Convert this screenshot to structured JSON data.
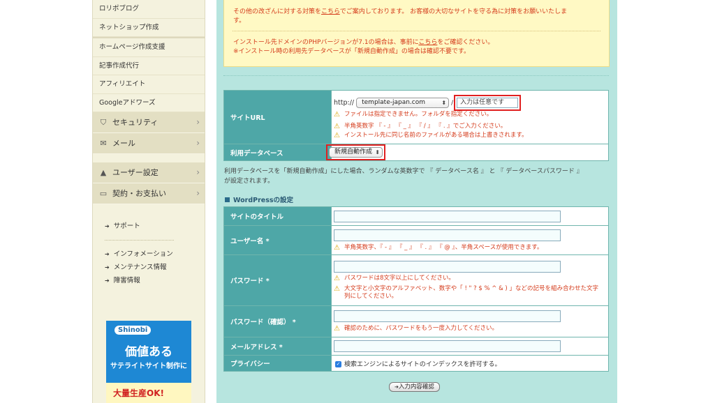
{
  "sidebar": {
    "links_top": [
      "ロリポブログ",
      "ネットショップ作成"
    ],
    "links_group2": [
      "ホームページ作成支援",
      "記事作成代行",
      "アフィリエイト",
      "Googleアドワーズ"
    ],
    "categories": [
      {
        "label": "セキュリティ",
        "icon": "shield-icon",
        "glyph": "⛉"
      },
      {
        "label": "メール",
        "icon": "mail-icon",
        "glyph": "✉"
      }
    ],
    "categories2": [
      {
        "label": "ユーザー設定",
        "icon": "user-icon",
        "glyph": "👤"
      },
      {
        "label": "契約・お支払い",
        "icon": "card-icon",
        "glyph": "▭"
      }
    ],
    "support": [
      "サポート"
    ],
    "info": [
      "インフォメーション",
      "メンテナンス情報",
      "障害情報"
    ],
    "banner": {
      "logo": "Shinobi",
      "main": "価値ある",
      "sub": "サテライトサイト制作に",
      "bottom": "大量生産OK!"
    }
  },
  "notice": {
    "line1_pre": "その他の改ざんに対する対策を",
    "line1_link": "こちら",
    "line1_post": "でご案内しております。 お客様の大切なサイトを守る為に対策をお願いいたしま",
    "line1_cont": "す。",
    "line2_pre": "インストール先ドメインのPHPバージョンが7.1の場合は、事前に",
    "line2_link": "こちら",
    "line2_post": "をご確認ください。",
    "line3": "※インストール時の利用先データベースが「新規自動作成」の場合は確認不要です。"
  },
  "site_form": {
    "url_label": "サイトURL",
    "url_prefix": "http://",
    "domain_selected": "template-japan.com",
    "slash": "/",
    "path_placeholder": "入力は任意です",
    "url_warnings": [
      "ファイルは指定できません。フォルダを指定ください。",
      "半角英数字 『 - 』 『 _ 』 『 / 』 『 . 』でご入力ください。",
      "インストール先に同じ名前のファイルがある場合は上書きされます。"
    ],
    "db_label": "利用データベース",
    "db_selected": "新規自動作成"
  },
  "db_note": {
    "line1": "利用データベースを「新規自動作成」にした場合、ランダムな英数字で 『 データベース名 』 と 『 データベースパスワード 』",
    "line2": "が設定されます。"
  },
  "wp_section": {
    "title": "WordPressの設定",
    "site_title_label": "サイトのタイトル",
    "username_label": "ユーザー名 *",
    "username_warning": "半角英数字、『 - 』 『 _ 』 『 . 』 『 @ 』、半角スペースが使用できます。",
    "password_label": "パスワード *",
    "password_warning1": "パスワードは8文字以上にしてください。",
    "password_warning2a": "大文字と小文字のアルファベット、数字や「 ! \" ? $ % ^ & ) 」などの記号を組み合わせた文字",
    "password_warning2b": "列にしてください。",
    "password_confirm_label": "パスワード（確認） *",
    "password_confirm_warning": "確認のために、パスワードをもう一度入力してください。",
    "email_label": "メールアドレス *",
    "privacy_label": "プライバシー",
    "privacy_text": "検索エンジンによるサイトのインデックスを許可する。",
    "privacy_checked": true
  },
  "confirm_button": "入力内容確認"
}
